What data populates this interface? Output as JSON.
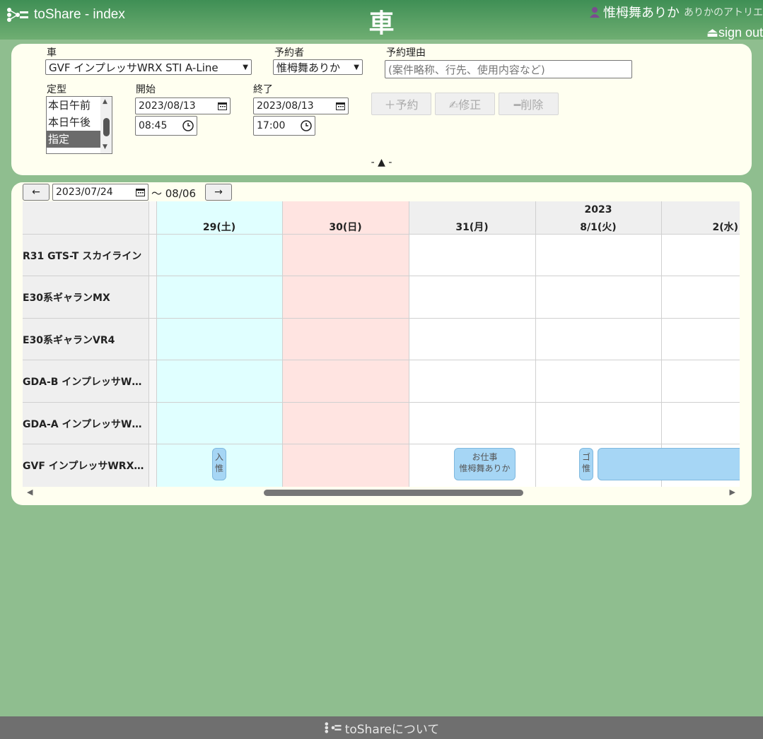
{
  "header": {
    "app_title": "toShare - index",
    "page_title": "車",
    "user_name": "惟栂舞ありか",
    "user_subtitle": "ありかのアトリエ",
    "signout": "⏏sign out"
  },
  "form": {
    "car_label": "車",
    "car_value": "GVF インプレッサWRX STI A-Line",
    "booker_label": "予約者",
    "booker_value": "惟栂舞ありか",
    "reason_label": "予約理由",
    "reason_placeholder": "(案件略称、行先、使用内容など)",
    "preset_label": "定型",
    "presets": [
      "本日午前",
      "本日午後",
      "指定"
    ],
    "start_label": "開始",
    "start_date": "2023/08/13",
    "start_time": "08:45",
    "end_label": "終了",
    "end_date": "2023/08/13",
    "end_time": "17:00",
    "reserve_button": "＋予約",
    "edit_button": "✍修正",
    "delete_button": "━削除",
    "collapse_toggle": "- ▲ -"
  },
  "calendar": {
    "prev_button": "←",
    "next_button": "→",
    "from_date": "2023/07/24",
    "range_to": "～ 08/06",
    "columns": [
      {
        "year": "",
        "day": "29(土)"
      },
      {
        "year": "",
        "day": "30(日)"
      },
      {
        "year": "",
        "day": "31(月)"
      },
      {
        "year": "2023",
        "day": "8/1(火)"
      },
      {
        "year": "",
        "day": "2(水)"
      }
    ],
    "rows": [
      "R31 GTS-T スカイライン",
      "E30系ギャランMX",
      "E30系ギャランVR4",
      "GDA-B インプレッサW…",
      "GDA-A インプレッサW…",
      "GVF インプレッサWRX…"
    ],
    "events": [
      {
        "title": "入",
        "person": "惟"
      },
      {
        "title": "お仕事",
        "person": "惟栂舞ありか"
      },
      {
        "title": "ゴ",
        "person": "惟"
      },
      {
        "title": "",
        "person": ""
      }
    ]
  },
  "footer": {
    "about": "toShareについて"
  },
  "colors": {
    "background": "#8fbe8f",
    "header": "#4f9a5e",
    "panel": "#fffff0",
    "saturday": "#e0ffff",
    "sunday": "#ffe4e1",
    "event": "#a6d6f5"
  }
}
